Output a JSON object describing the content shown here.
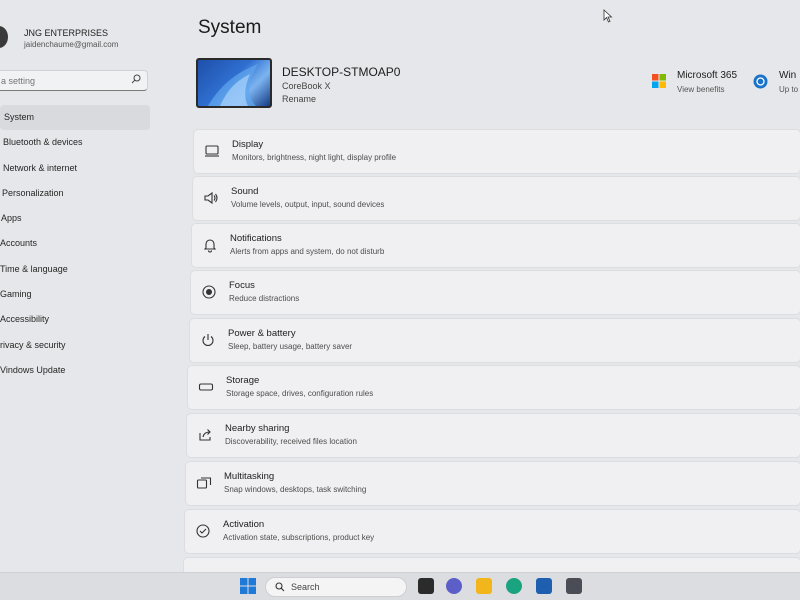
{
  "account": {
    "name": "JNG ENTERPRISES",
    "email": "jaidenchaume@gmail.com"
  },
  "search": {
    "placeholder": "a setting"
  },
  "nav": [
    {
      "label": "System",
      "active": true
    },
    {
      "label": "Bluetooth & devices"
    },
    {
      "label": "Network & internet"
    },
    {
      "label": "Personalization"
    },
    {
      "label": "Apps"
    },
    {
      "label": "Accounts"
    },
    {
      "label": "Time & language"
    },
    {
      "label": "Gaming"
    },
    {
      "label": "Accessibility"
    },
    {
      "label": "rivacy & security"
    },
    {
      "label": "Vindows Update"
    }
  ],
  "page": {
    "title": "System"
  },
  "device": {
    "name": "DESKTOP-STMOAP0",
    "model": "CoreBook X",
    "rename": "Rename"
  },
  "promos": {
    "microsoft365": {
      "title": "Microsoft 365",
      "sub": "View benefits"
    },
    "windows_update": {
      "title": "Win",
      "sub": "Up to"
    }
  },
  "cards": [
    {
      "icon": "display-icon",
      "title": "Display",
      "sub": "Monitors, brightness, night light, display profile"
    },
    {
      "icon": "sound-icon",
      "title": "Sound",
      "sub": "Volume levels, output, input, sound devices"
    },
    {
      "icon": "bell-icon",
      "title": "Notifications",
      "sub": "Alerts from apps and system, do not disturb"
    },
    {
      "icon": "focus-icon",
      "title": "Focus",
      "sub": "Reduce distractions"
    },
    {
      "icon": "power-icon",
      "title": "Power & battery",
      "sub": "Sleep, battery usage, battery saver"
    },
    {
      "icon": "storage-icon",
      "title": "Storage",
      "sub": "Storage space, drives, configuration rules"
    },
    {
      "icon": "share-icon",
      "title": "Nearby sharing",
      "sub": "Discoverability, received files location"
    },
    {
      "icon": "multitasking-icon",
      "title": "Multitasking",
      "sub": "Snap windows, desktops, task switching"
    },
    {
      "icon": "activation-icon",
      "title": "Activation",
      "sub": "Activation state, subscriptions, product key"
    }
  ],
  "taskbar": {
    "search_label": "Search"
  },
  "colors": {
    "accent": "#0067c0",
    "background": "#e6e7ea",
    "card": "#f0f0f2"
  }
}
